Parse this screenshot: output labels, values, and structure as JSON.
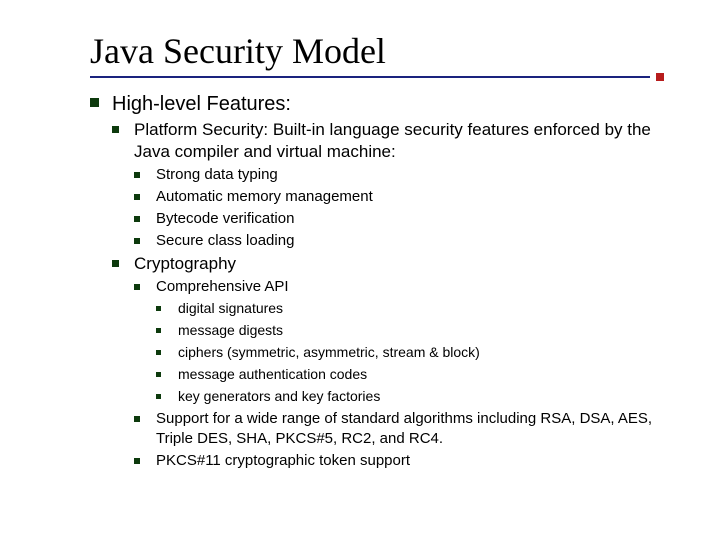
{
  "title": "Java Security Model",
  "lvl1": {
    "text": "High-level Features:",
    "children": [
      {
        "text": "Platform Security: Built-in language security features enforced by the Java compiler and virtual machine:",
        "children": [
          {
            "text": "Strong data typing"
          },
          {
            "text": "Automatic memory management"
          },
          {
            "text": "Bytecode verification"
          },
          {
            "text": "Secure class loading"
          }
        ]
      },
      {
        "text": "Cryptography",
        "children": [
          {
            "text": "Comprehensive API",
            "children": [
              {
                "text": "digital signatures"
              },
              {
                "text": "message digests"
              },
              {
                "text": "ciphers (symmetric, asymmetric, stream & block)"
              },
              {
                "text": "message authentication codes"
              },
              {
                "text": "key generators and key factories"
              }
            ]
          },
          {
            "text": "Support for a wide range of standard algorithms including RSA, DSA, AES, Triple DES, SHA, PKCS#5, RC2, and RC4."
          },
          {
            "text": "PKCS#11 cryptographic token support"
          }
        ]
      }
    ]
  }
}
